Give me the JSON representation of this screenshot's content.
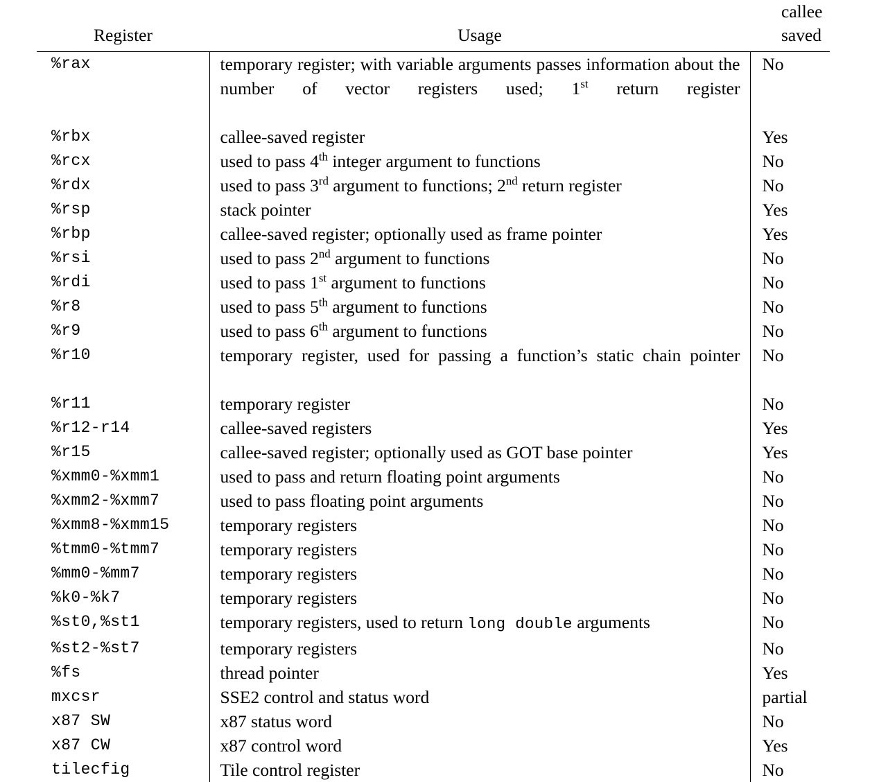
{
  "table": {
    "headers": {
      "register": "Register",
      "usage": "Usage",
      "callee_saved": "callee\nsaved"
    },
    "rows": [
      {
        "register": "%rax",
        "usage": "temporary register; with variable arguments passes information about the number of vector registers used; 1st return register",
        "usage_html": "temporary register; with variable arguments passes information about the number of vector registers used; 1<sup>st</sup> return register",
        "callee_saved": "No",
        "lines": 2
      },
      {
        "register": "%rbx",
        "usage": "callee-saved register",
        "usage_html": "callee-saved register",
        "callee_saved": "Yes",
        "lines": 1
      },
      {
        "register": "%rcx",
        "usage": "used to pass 4th integer argument to functions",
        "usage_html": "used to pass 4<sup>th</sup> integer argument to functions",
        "callee_saved": "No",
        "lines": 1
      },
      {
        "register": "%rdx",
        "usage": "used to pass 3rd argument to functions; 2nd return register",
        "usage_html": "used to pass 3<sup>rd</sup> argument to functions; 2<sup>nd</sup> return register",
        "callee_saved": "No",
        "lines": 1
      },
      {
        "register": "%rsp",
        "usage": "stack pointer",
        "usage_html": "stack pointer",
        "callee_saved": "Yes",
        "lines": 1
      },
      {
        "register": "%rbp",
        "usage": "callee-saved register; optionally used as frame pointer",
        "usage_html": "callee-saved register; optionally used as frame pointer",
        "callee_saved": "Yes",
        "lines": 1
      },
      {
        "register": "%rsi",
        "usage": "used to pass 2nd argument to functions",
        "usage_html": "used to pass 2<sup>nd</sup> argument to functions",
        "callee_saved": "No",
        "lines": 1
      },
      {
        "register": "%rdi",
        "usage": "used to pass 1st argument to functions",
        "usage_html": "used to pass 1<sup>st</sup> argument to functions",
        "callee_saved": "No",
        "lines": 1
      },
      {
        "register": "%r8",
        "usage": "used to pass 5th argument to functions",
        "usage_html": "used to pass 5<sup>th</sup> argument to functions",
        "callee_saved": "No",
        "lines": 1
      },
      {
        "register": "%r9",
        "usage": "used to pass 6th argument to functions",
        "usage_html": "used to pass 6<sup>th</sup> argument to functions",
        "callee_saved": "No",
        "lines": 1
      },
      {
        "register": "%r10",
        "usage": "temporary register, used for passing a function's static chain pointer",
        "usage_html": "temporary register, used for passing a function’s static chain pointer",
        "callee_saved": "No",
        "lines": 2
      },
      {
        "register": "%r11",
        "usage": "temporary register",
        "usage_html": "temporary register",
        "callee_saved": "No",
        "lines": 1
      },
      {
        "register": "%r12-r14",
        "usage": "callee-saved registers",
        "usage_html": "callee-saved registers",
        "callee_saved": "Yes",
        "lines": 1
      },
      {
        "register": "%r15",
        "usage": "callee-saved register; optionally used as GOT base pointer",
        "usage_html": "callee-saved register; optionally used as GOT base pointer",
        "callee_saved": "Yes",
        "lines": 1
      },
      {
        "register": "%xmm0-%xmm1",
        "usage": "used to pass and return floating point arguments",
        "usage_html": "used to pass and return floating point arguments",
        "callee_saved": "No",
        "lines": 1
      },
      {
        "register": "%xmm2-%xmm7",
        "usage": "used to pass floating point arguments",
        "usage_html": "used to pass floating point arguments",
        "callee_saved": "No",
        "lines": 1
      },
      {
        "register": "%xmm8-%xmm15",
        "usage": "temporary registers",
        "usage_html": "temporary registers",
        "callee_saved": "No",
        "lines": 1
      },
      {
        "register": "%tmm0-%tmm7",
        "usage": "temporary registers",
        "usage_html": "temporary registers",
        "callee_saved": "No",
        "lines": 1
      },
      {
        "register": "%mm0-%mm7",
        "usage": "temporary registers",
        "usage_html": "temporary registers",
        "callee_saved": "No",
        "lines": 1
      },
      {
        "register": "%k0-%k7",
        "usage": "temporary registers",
        "usage_html": "temporary registers",
        "callee_saved": "No",
        "lines": 1
      },
      {
        "register": "%st0,%st1",
        "usage": "temporary registers, used to return long double arguments",
        "usage_html": "temporary registers, used to return <code class=\"mono\">long double</code> arguments",
        "callee_saved": "No",
        "lines": 1
      },
      {
        "register": "%st2-%st7",
        "usage": "temporary registers",
        "usage_html": "temporary registers",
        "callee_saved": "No",
        "lines": 1
      },
      {
        "register": "%fs",
        "usage": "thread pointer",
        "usage_html": "thread pointer",
        "callee_saved": "Yes",
        "lines": 1
      },
      {
        "register": "mxcsr",
        "usage": "SSE2 control and status word",
        "usage_html": "SSE2 control and status word",
        "callee_saved": "partial",
        "lines": 1
      },
      {
        "register": "x87 SW",
        "usage": "x87 status word",
        "usage_html": "x87 status word",
        "callee_saved": "No",
        "lines": 1
      },
      {
        "register": "x87 CW",
        "usage": "x87 control word",
        "usage_html": "x87 control word",
        "callee_saved": "Yes",
        "lines": 1
      },
      {
        "register": "tilecfig",
        "usage": "Tile control register",
        "usage_html": "Tile control register",
        "callee_saved": "No",
        "lines": 1
      }
    ]
  }
}
